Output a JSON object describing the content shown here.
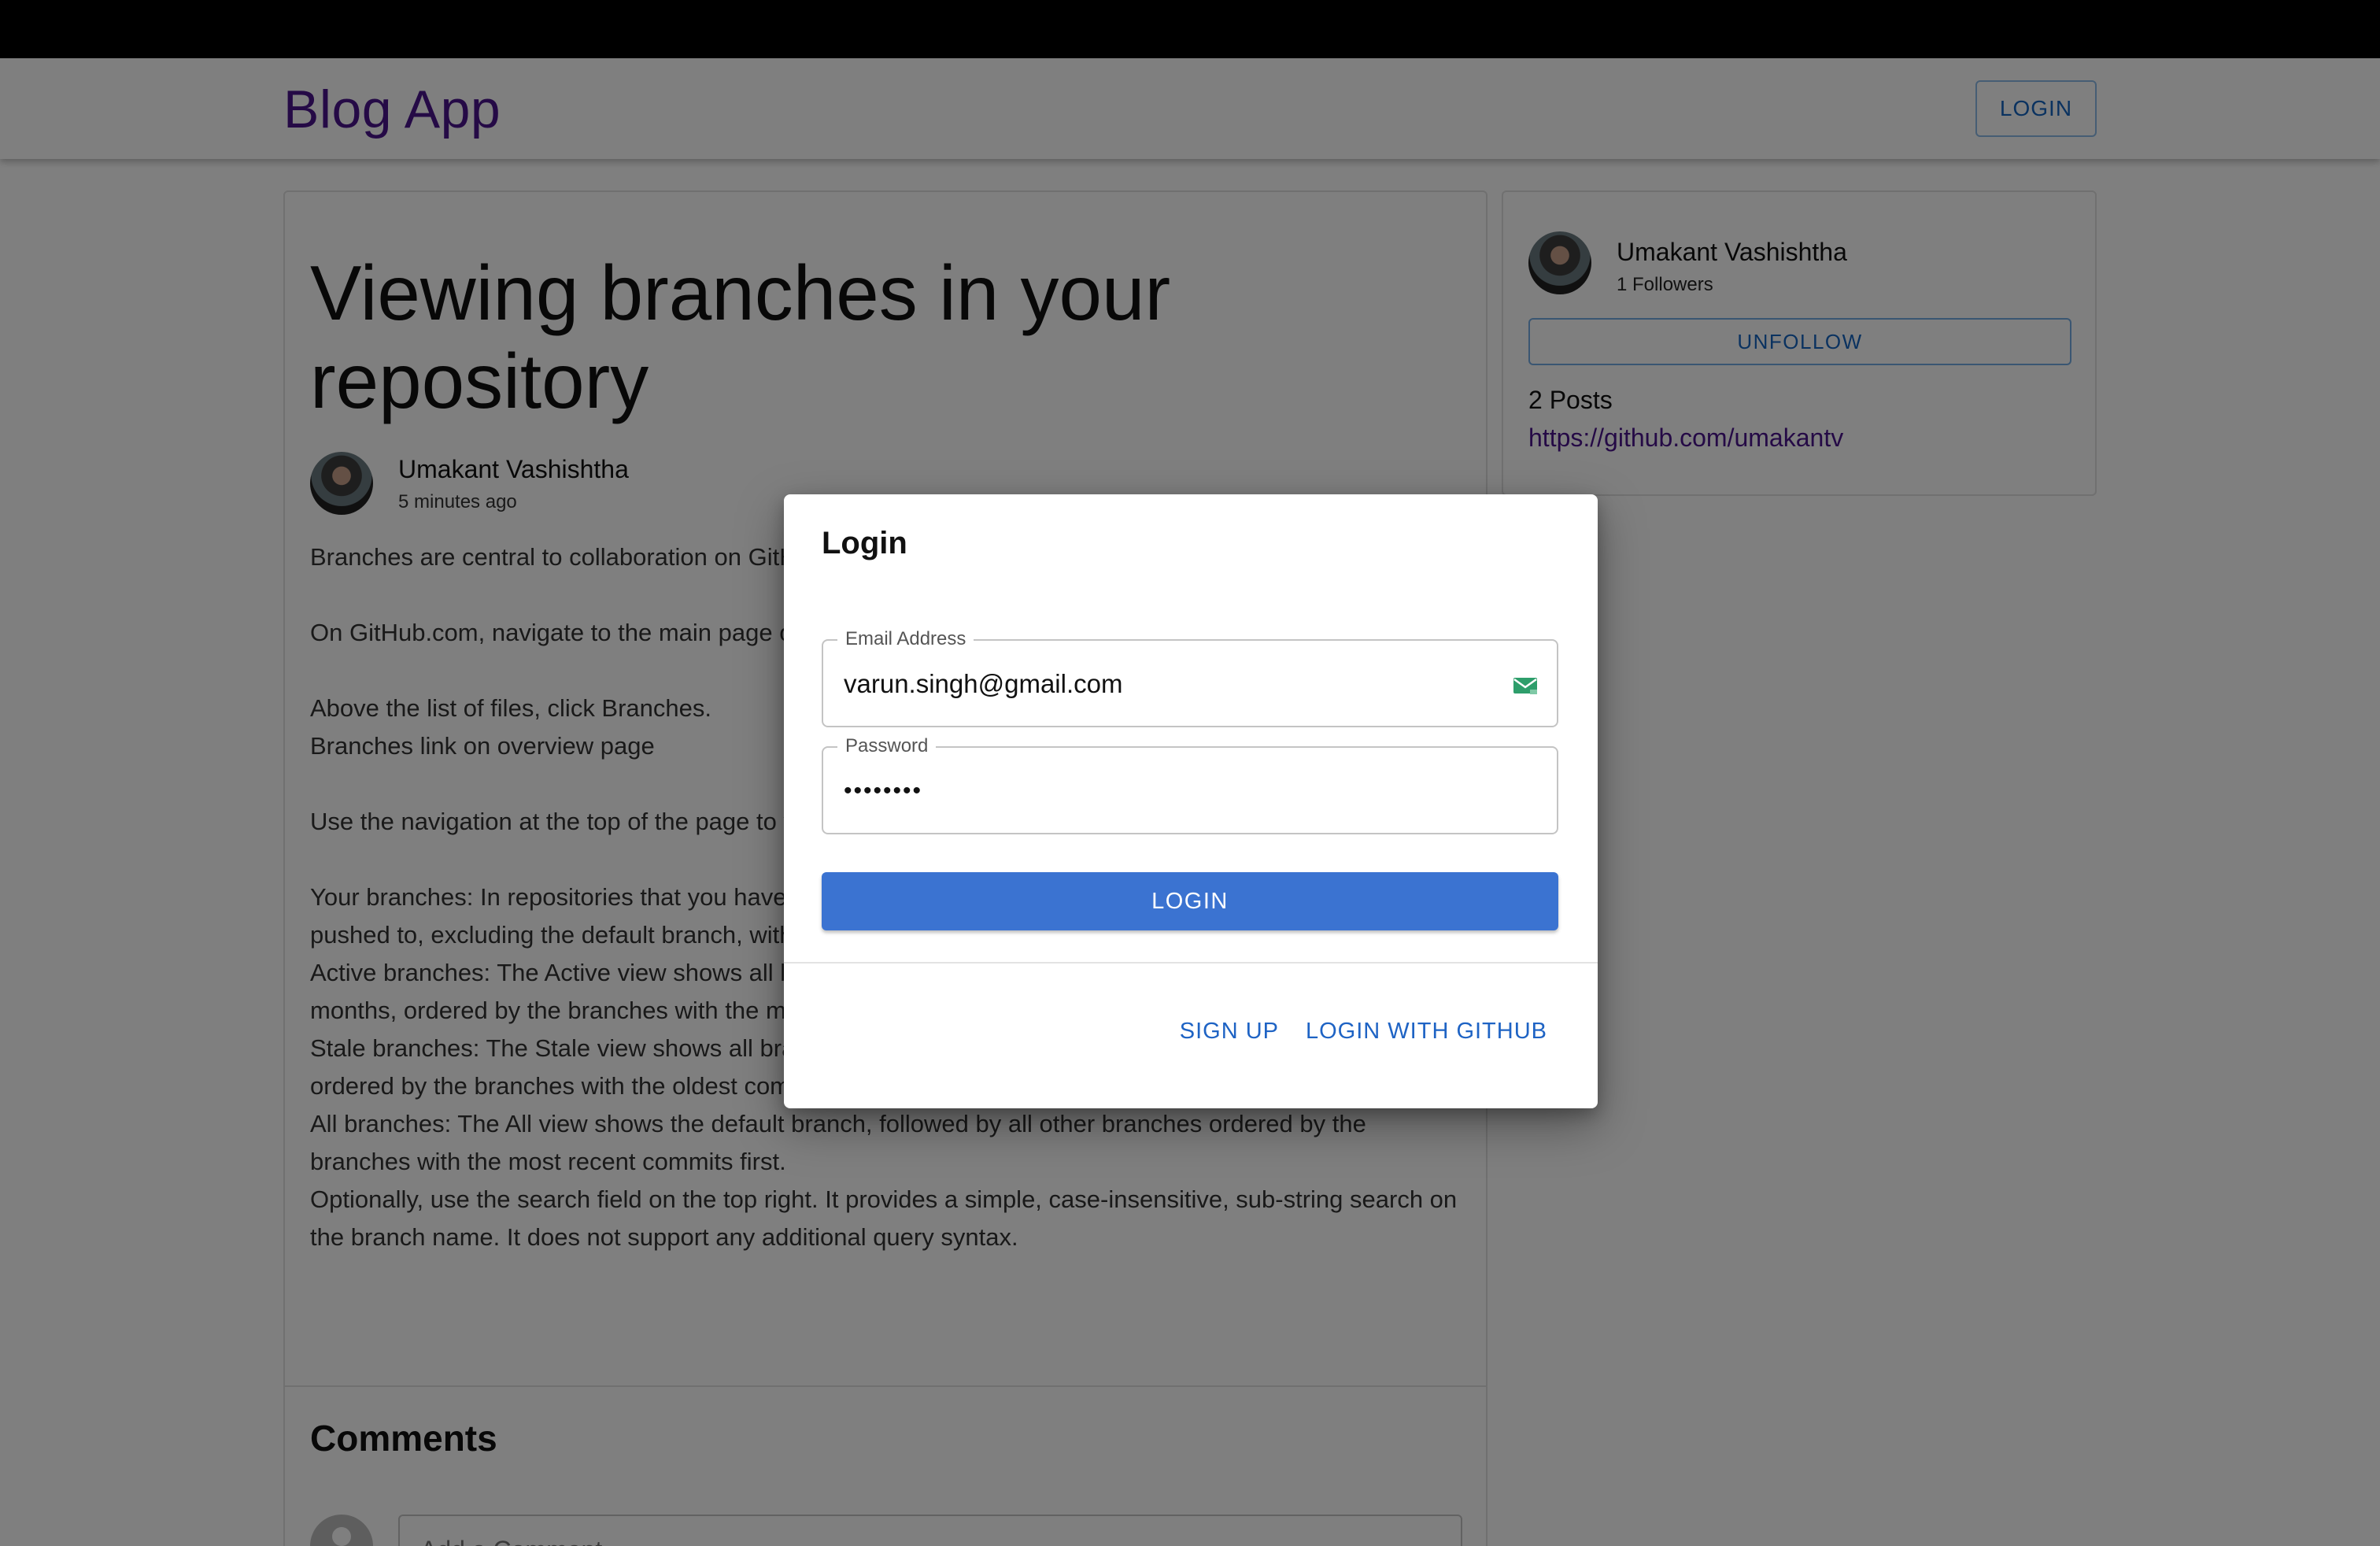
{
  "header": {
    "brand": "Blog App",
    "login_label": "LOGIN"
  },
  "article": {
    "title": "Viewing branches in your repository",
    "author": "Umakant Vashishtha",
    "time_ago": "5 minutes ago",
    "paragraphs": [
      "Branches are central to collaboration on GitHub. The best way to view them is the branches page.",
      "",
      "On GitHub.com, navigate to the main page of the repository.",
      "",
      "Above the list of files, click  Branches.",
      "Branches link on overview page",
      "",
      "Use the navigation at the top of the page to view specific lists of branches:",
      "",
      "Your branches: In repositories that you have push access to, the Yours view shows all branches you’ve pushed to, excluding the default branch, with the most recent branches first.",
      "Active branches: The Active view shows all branches that anyone has committed to within the last three months, ordered by the branches with the most recent commits first.",
      "Stale branches: The Stale view shows all branches that no one has committed to in the last three months, ordered by the branches with the oldest commits first. Use this list to determine which branches to delete.",
      "All branches: The All view shows the default branch, followed by all other branches ordered by the branches with the most recent commits first.",
      "Optionally, use the search field on the top right. It provides a simple, case-insensitive, sub-string search on the branch name. It does not support any additional query syntax."
    ],
    "comments_title": "Comments",
    "comment_placeholder": "Add a Comment"
  },
  "profile": {
    "name": "Umakant Vashishtha",
    "followers": "1 Followers",
    "unfollow_label": "UNFOLLOW",
    "posts": "2 Posts",
    "link": "https://github.com/umakantv"
  },
  "dialog": {
    "title": "Login",
    "email_label": "Email Address",
    "email_value": "varun.singh@gmail.com",
    "password_label": "Password",
    "password_value": "••••••••",
    "login_label": "LOGIN",
    "signup_label": "SIGN UP",
    "github_label": "LOGIN WITH GITHUB",
    "icons": {
      "email": "mail-icon"
    },
    "colors": {
      "primary": "#3b73d1",
      "icon": "#2e9e6b"
    }
  }
}
